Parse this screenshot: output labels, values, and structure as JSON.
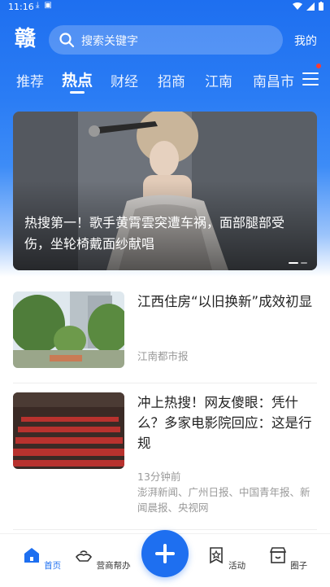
{
  "status_bar": {
    "time": "11:16"
  },
  "search": {
    "placeholder": "搜索关键字"
  },
  "header": {
    "mine_label": "我的"
  },
  "tabs": [
    "推荐",
    "热点",
    "财经",
    "招商",
    "江南",
    "南昌市"
  ],
  "featured": {
    "title": "热搜第一！歌手黄霄雲突遭车祸，面部腿部受伤，坐轮椅戴面纱献唱"
  },
  "news": [
    {
      "title": "江西住房“以旧换新”成效初显",
      "source": "江南都市报"
    },
    {
      "title": "冲上热搜！网友傻眼：凭什么？多家电影院回应：这是行规",
      "time": "13分钟前",
      "sources": "澎湃新闻、广州日报、中国青年报、新闻晨报、央视网"
    }
  ],
  "bottom_nav": {
    "home": "首页",
    "business_help": "营商帮办",
    "activity": "活动",
    "circle": "圈子"
  },
  "colors": {
    "brand": "#1e6ff0",
    "accent_dot": "#ff3b30"
  }
}
